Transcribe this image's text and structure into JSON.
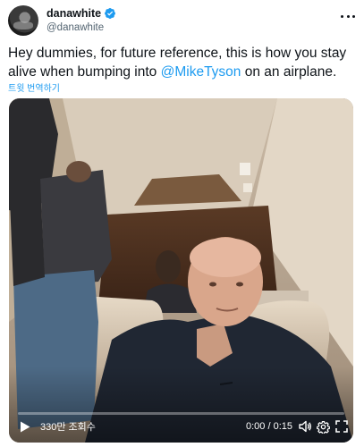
{
  "author": {
    "display_name": "danawhite",
    "handle": "@danawhite",
    "verified": true
  },
  "tweet": {
    "text_before": "Hey dummies, for future reference, this is how you stay alive when bumping into ",
    "mention": "@MikeTyson",
    "text_after": " on an airplane.",
    "translate_label": "트윗 번역하기"
  },
  "video": {
    "views_label": "330만 조회수",
    "time_label": "0:00 / 0:15",
    "progress": 0
  },
  "icons": {
    "more": "more-icon",
    "verified": "verified-badge-icon",
    "play": "play-icon",
    "volume": "volume-icon",
    "settings": "gear-icon",
    "fullscreen": "fullscreen-icon"
  },
  "colors": {
    "accent": "#1d9bf0",
    "text": "#0f1419",
    "secondary": "#536471"
  }
}
